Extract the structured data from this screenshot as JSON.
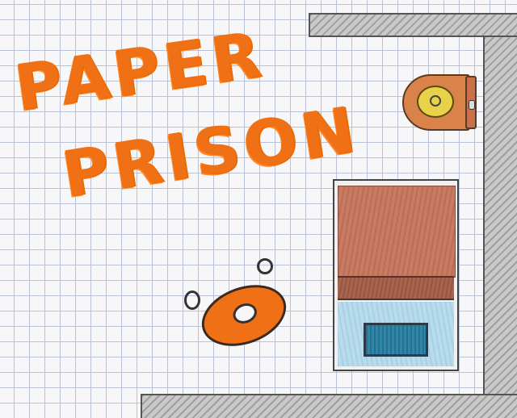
{
  "title": {
    "line1": "PAPER",
    "line2": "PRISON"
  },
  "colors": {
    "title_orange": "#f07016",
    "paper": "#f7f7f9",
    "grid_line": "#b9c2d8",
    "wall_gray": "#c9c9c9",
    "blanket": "#c97a62",
    "sheet": "#b9dcec",
    "pillow": "#2f86a8",
    "toilet_seat": "#e8d24a",
    "toilet_body": "#d9824a"
  },
  "scene": {
    "objects": [
      "wall",
      "toilet",
      "bed",
      "player-blob",
      "bubbles"
    ]
  }
}
